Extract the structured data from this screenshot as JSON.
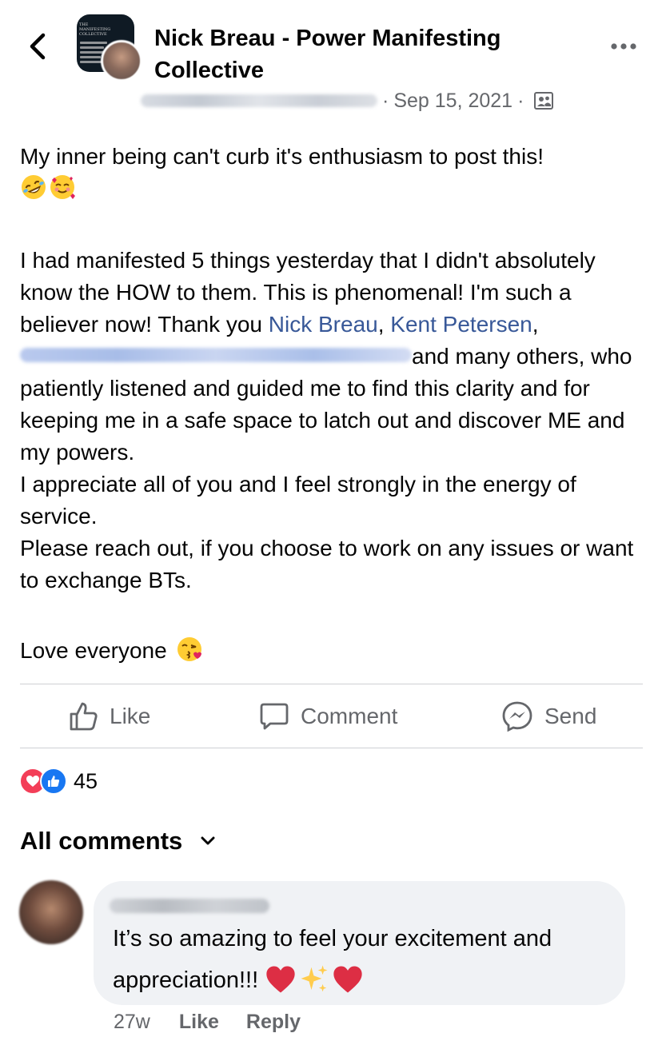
{
  "post": {
    "title": "Nick Breau - Power Manifesting Collective",
    "date": "Sep 15, 2021",
    "separator": "·",
    "privacy_icon": "members-icon",
    "group_avatar_text": "THE MANIFESTING COLLECTIVE",
    "body": {
      "p1": "My inner being can't curb it's enthusiasm to post this!",
      "p1_emojis": [
        "rolling-on-floor-laughing",
        "smiling-face-with-hearts"
      ],
      "p2_a": "I had manifested 5 things yesterday that I didn't absolutely know the HOW to them. This is phenomenal! I'm such a believer now! Thank you ",
      "mention1": "Nick Breau",
      "comma1": ", ",
      "mention2": "Kent Petersen",
      "comma2": ", ",
      "p2_b": "and  many others, who patiently listened and guided me to find this clarity and for keeping me in a safe space to latch out and discover ME and my powers.",
      "p3": "I appreciate all of you and I feel strongly in the energy of service.",
      "p4": "Please reach out, if you choose to work on any issues or want to exchange BTs.",
      "p5": "Love everyone",
      "p5_emoji": "face-blowing-a-kiss"
    }
  },
  "actions": {
    "like_label": "Like",
    "comment_label": "Comment",
    "send_label": "Send"
  },
  "reactions": {
    "icons": [
      "love-reaction-icon",
      "like-reaction-icon"
    ],
    "count": "45"
  },
  "comments_section": {
    "heading": "All comments"
  },
  "comment": {
    "text": "It’s so amazing to feel your excitement and appreciation!!! ",
    "emojis": [
      "red-heart",
      "sparkles",
      "red-heart"
    ],
    "time": "27w",
    "like_label": "Like",
    "reply_label": "Reply"
  },
  "colors": {
    "link": "#385898",
    "secondary_text": "#65676b",
    "divider": "#ced0d4",
    "bubble": "#f0f2f5",
    "love": "#f33e58",
    "like": "#1877f2"
  }
}
